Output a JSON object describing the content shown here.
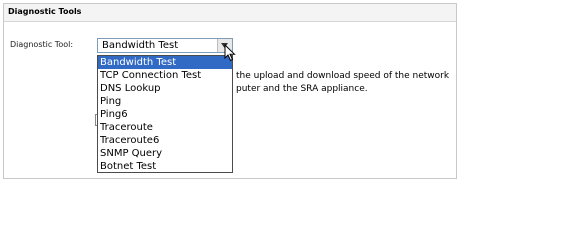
{
  "panel": {
    "title": "Diagnostic Tools"
  },
  "form": {
    "label": "Diagnostic Tool:",
    "selected": "Bandwidth Test",
    "options": [
      "Bandwidth Test",
      "TCP Connection Test",
      "DNS Lookup",
      "Ping",
      "Ping6",
      "Traceroute",
      "Traceroute6",
      "SNMP Query",
      "Botnet Test"
    ]
  },
  "description": {
    "line1": "the upload and download speed of the network",
    "line2": "puter and the SRA appliance."
  },
  "colors": {
    "highlight": "#316ac5"
  }
}
